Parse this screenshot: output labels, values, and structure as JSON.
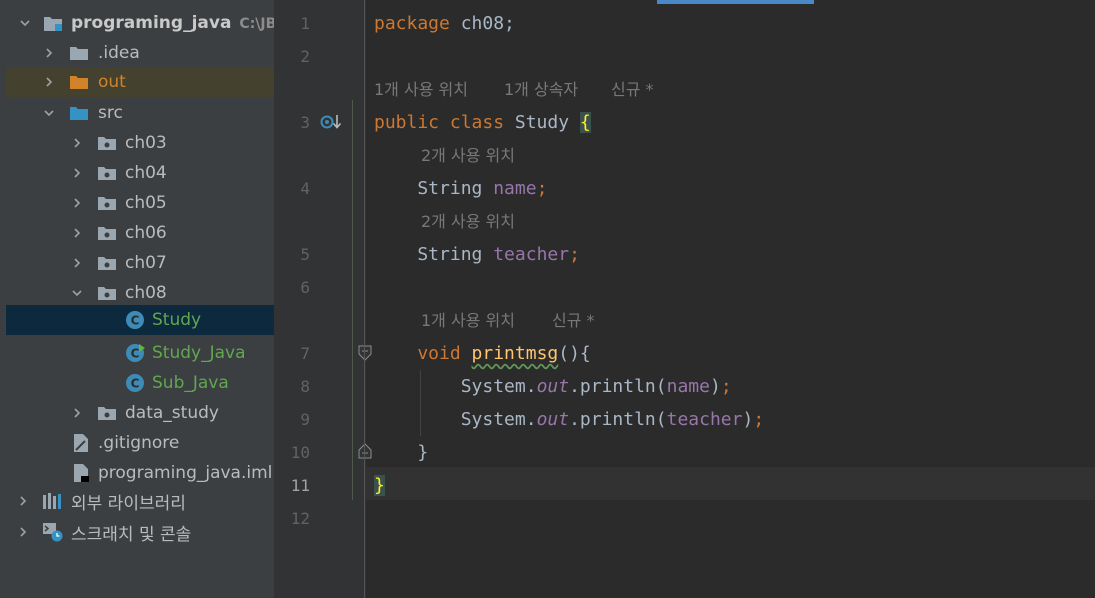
{
  "project_tree": {
    "root": {
      "label": "programing_java",
      "path_hint": "C:\\JB..."
    },
    "items": [
      {
        "label": ".idea"
      },
      {
        "label": "out"
      },
      {
        "label": "src"
      },
      {
        "label": "ch03"
      },
      {
        "label": "ch04"
      },
      {
        "label": "ch05"
      },
      {
        "label": "ch06"
      },
      {
        "label": "ch07"
      },
      {
        "label": "ch08"
      },
      {
        "label": "Study"
      },
      {
        "label": "Study_Java"
      },
      {
        "label": "Sub_Java"
      },
      {
        "label": "data_study"
      },
      {
        "label": ".gitignore"
      },
      {
        "label": "programing_java.iml"
      },
      {
        "label": "외부 라이브러리"
      },
      {
        "label": "스크래치 및 콘솔"
      }
    ]
  },
  "editor": {
    "line_numbers": [
      "1",
      "2",
      "3",
      "4",
      "5",
      "6",
      "7",
      "8",
      "9",
      "10",
      "11",
      "12"
    ],
    "current_line": "11",
    "hints": {
      "class_usages": "1개 사용 위치",
      "class_inheritors": "1개 상속자",
      "class_new": "신규 *",
      "name_usages": "2개 사용 위치",
      "teacher_usages": "2개 사용 위치",
      "method_usages": "1개 사용 위치",
      "method_new": "신규 *"
    },
    "code": {
      "l1_kw": "package",
      "l1_rest": " ch08;",
      "l3_kw": "public class",
      "l3_name": " Study ",
      "l3_brace": "{",
      "l4_type": "    String ",
      "l4_field": "name",
      "l4_semi": ";",
      "l5_type": "    String ",
      "l5_field": "teacher",
      "l5_semi": ";",
      "l7_kw": "    void",
      "l7_sp": " ",
      "l7_fn": "printmsg",
      "l7_rest": "(){",
      "l8_a": "        System.",
      "l8_out": "out",
      "l8_b": ".println(",
      "l8_arg": "name",
      "l8_c": ")",
      "l8_semi": ";",
      "l9_a": "        System.",
      "l9_out": "out",
      "l9_b": ".println(",
      "l9_arg": "teacher",
      "l9_c": ")",
      "l9_semi": ";",
      "l10": "    }",
      "l11_brace": "}"
    }
  },
  "colors": {
    "keyword": "#cc7832",
    "field": "#9876aa",
    "method": "#ffc66d",
    "text": "#a9b7c6",
    "background": "#2b2b2b",
    "selection": "#0d293e"
  }
}
